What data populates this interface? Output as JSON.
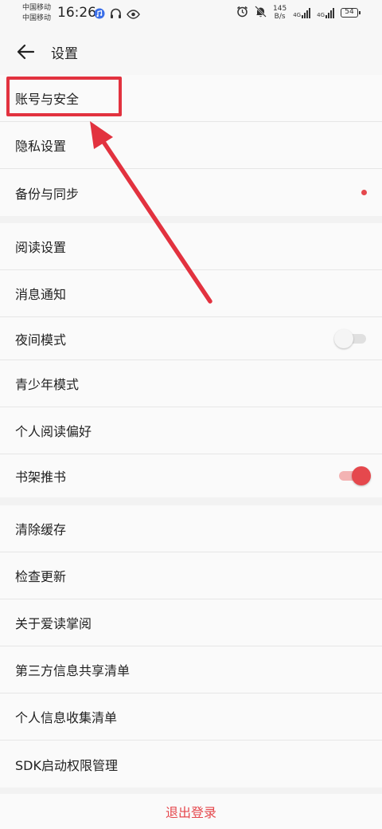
{
  "status_bar": {
    "carrier_1": "中国移动",
    "carrier_2": "中国移动",
    "time": "16:26",
    "speed_value": "145",
    "speed_unit": "B/s",
    "signal_1": "4G",
    "signal_2": "4G",
    "battery": "54"
  },
  "header": {
    "title": "设置"
  },
  "groups": [
    {
      "items": [
        {
          "label": "账号与安全"
        },
        {
          "label": "隐私设置"
        },
        {
          "label": "备份与同步",
          "badge": "red-dot"
        }
      ]
    },
    {
      "items": [
        {
          "label": "阅读设置"
        },
        {
          "label": "消息通知"
        },
        {
          "label": "夜间模式",
          "toggle": "off"
        },
        {
          "label": "青少年模式"
        },
        {
          "label": "个人阅读偏好"
        },
        {
          "label": "书架推书",
          "toggle": "on"
        }
      ]
    },
    {
      "items": [
        {
          "label": "清除缓存"
        },
        {
          "label": "检查更新"
        },
        {
          "label": "关于爱读掌阅"
        },
        {
          "label": "第三方信息共享清单"
        },
        {
          "label": "个人信息收集清单"
        },
        {
          "label": "SDK启动权限管理"
        }
      ]
    }
  ],
  "logout": {
    "label": "退出登录"
  },
  "colors": {
    "accent": "#e5484d",
    "annotation": "#e2323f"
  },
  "icons": [
    "back-arrow-icon",
    "alarm-icon",
    "mute-icon",
    "headphones-icon",
    "eye-icon",
    "music-icon"
  ]
}
